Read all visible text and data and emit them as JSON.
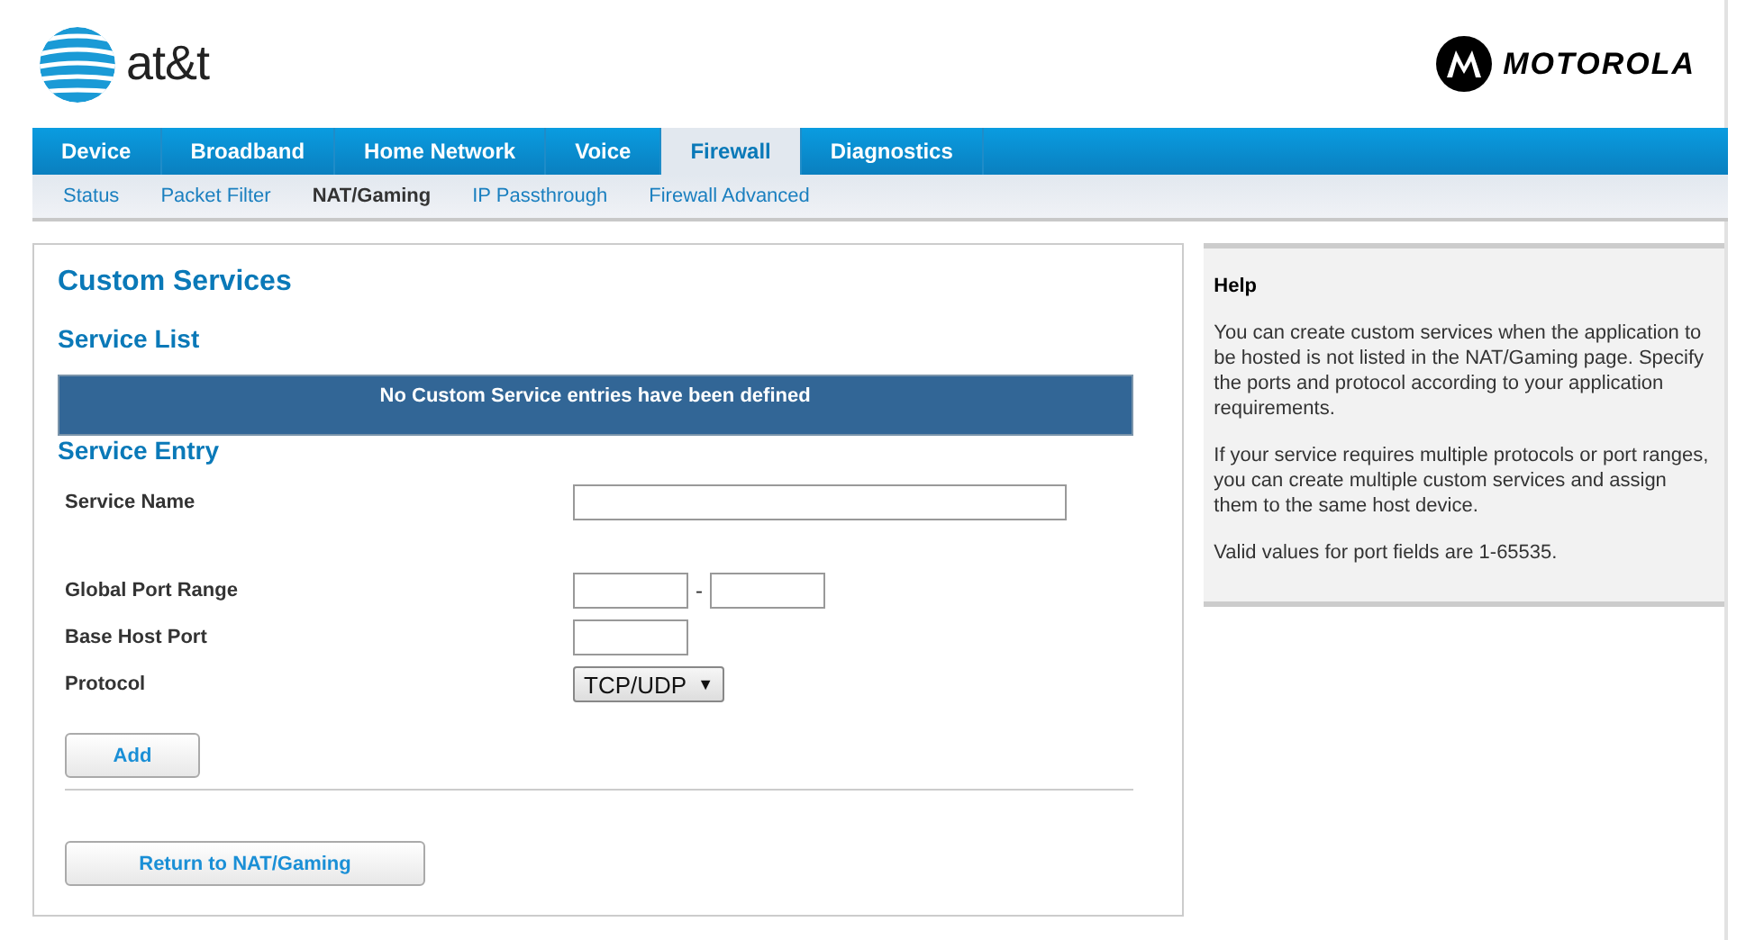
{
  "header": {
    "left_logo": "at&t",
    "right_logo": "MOTOROLA"
  },
  "tabs": [
    {
      "label": "Device",
      "selected": false
    },
    {
      "label": "Broadband",
      "selected": false
    },
    {
      "label": "Home Network",
      "selected": false
    },
    {
      "label": "Voice",
      "selected": false
    },
    {
      "label": "Firewall",
      "selected": true
    },
    {
      "label": "Diagnostics",
      "selected": false
    }
  ],
  "subtabs": [
    {
      "label": "Status",
      "selected": false
    },
    {
      "label": "Packet Filter",
      "selected": false
    },
    {
      "label": "NAT/Gaming",
      "selected": true
    },
    {
      "label": "IP Passthrough",
      "selected": false
    },
    {
      "label": "Firewall Advanced",
      "selected": false
    }
  ],
  "main": {
    "title": "Custom Services",
    "list_heading": "Service List",
    "list_message": "No Custom Service entries have been defined",
    "entry_heading": "Service Entry",
    "fields": [
      {
        "kind": "text",
        "label": "Service Name"
      },
      {
        "kind": "range",
        "label": "Global Port Range",
        "separator": "-"
      },
      {
        "kind": "port",
        "label": "Base Host Port"
      },
      {
        "kind": "select",
        "label": "Protocol",
        "value": "TCP/UDP",
        "arrow": "▼"
      }
    ],
    "add_button": "Add",
    "return_button": "Return to NAT/Gaming"
  },
  "help": {
    "title": "Help",
    "paragraphs": [
      "You can create custom services when the application to be hosted is not listed in the NAT/Gaming page. Specify the ports and protocol according to your application requirements.",
      "If your service requires multiple protocols or port ranges, you can create multiple custom services and assign them to the same host device.",
      "Valid values for port fields are 1-65535."
    ]
  }
}
